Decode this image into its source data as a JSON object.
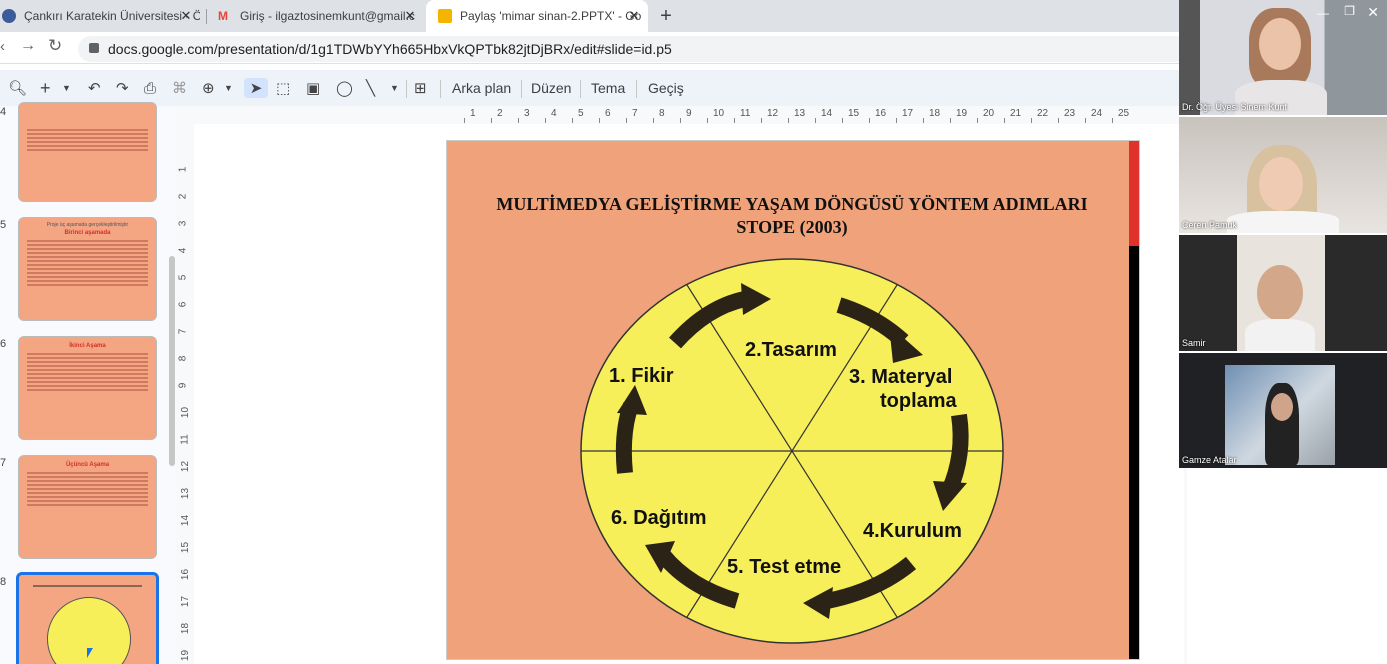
{
  "browser": {
    "tabs": [
      {
        "title": "Çankırı Karatekin Üniversitesi - Ö",
        "icon": "university-favicon-icon",
        "color": "#3b5b9a"
      },
      {
        "title": "Giriş - ilgaztosinemkunt@gmail.c",
        "icon": "gmail-icon",
        "color": "#ea4335"
      },
      {
        "title": "Paylaş 'mimar sinan-2.PPTX' - Go",
        "icon": "google-slides-icon",
        "color": "#f4b400"
      }
    ],
    "url": "docs.google.com/presentation/d/1g1TDWbYYh665HbxVkQPTbk82jtDjBRx/edit#slide=id.p5"
  },
  "toolbar": {
    "background": "Arka plan",
    "layout": "Düzen",
    "theme": "Tema",
    "transition": "Geçiş"
  },
  "filmstrip": [
    {
      "number": "4",
      "title": "",
      "subtitle": ""
    },
    {
      "number": "5",
      "title": "Birinci aşamada",
      "subtitle": "Proje üç aşamada gerçekleştirilmiştir"
    },
    {
      "number": "6",
      "title": "İkinci Aşama",
      "subtitle": ""
    },
    {
      "number": "7",
      "title": "Üçüncü Aşama",
      "subtitle": ""
    },
    {
      "number": "8",
      "title": "",
      "subtitle": ""
    }
  ],
  "ruler": {
    "horizontal": [
      "1",
      "2",
      "3",
      "4",
      "5",
      "6",
      "7",
      "8",
      "9",
      "10",
      "11",
      "12",
      "13",
      "14",
      "15",
      "16",
      "17",
      "18",
      "19",
      "20",
      "21",
      "22",
      "23",
      "24",
      "25"
    ],
    "vertical": [
      "1",
      "2",
      "3",
      "4",
      "5",
      "6",
      "7",
      "8",
      "9",
      "10",
      "11",
      "12",
      "13",
      "14",
      "15",
      "16",
      "17",
      "18",
      "19"
    ]
  },
  "slide": {
    "title_line1": "MULTİMEDYA GELİŞTİRME YAŞAM DÖNGÜSÜ YÖNTEM ADIMLARI",
    "title_line2": "STOPE (2003)",
    "steps": {
      "s1": "1. Fikir",
      "s2": "2.Tasarım",
      "s3a": "3.  Materyal",
      "s3b": "toplama",
      "s4": "4.Kurulum",
      "s5": "5. Test etme",
      "s6": "6. Dağıtım"
    },
    "colors": {
      "background": "#f0a27a",
      "circle": "#f7ef5a",
      "accent_red": "#e0312a"
    }
  },
  "participants": [
    {
      "name": "Dr. Öğr. Üyesi Sinem Kunt"
    },
    {
      "name": "Ceren Pamuk"
    },
    {
      "name": "Samir"
    },
    {
      "name": "Gamze Atalar"
    }
  ]
}
